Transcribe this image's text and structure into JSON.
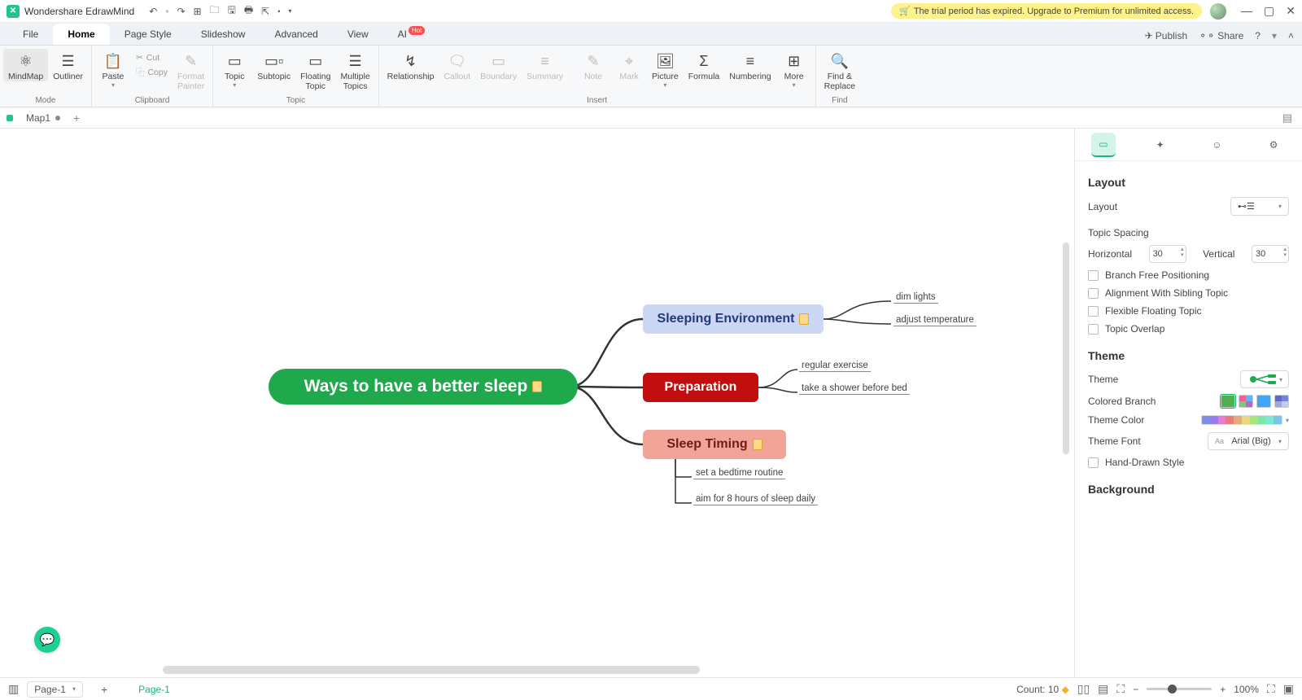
{
  "title_bar": {
    "app_name": "Wondershare EdrawMind",
    "trial_banner": "The trial period has expired. Upgrade to Premium for unlimited access."
  },
  "menu": {
    "file": "File",
    "home": "Home",
    "page_style": "Page Style",
    "slideshow": "Slideshow",
    "advanced": "Advanced",
    "view": "View",
    "ai": "AI",
    "ai_badge": "Hot",
    "publish": "Publish",
    "share": "Share"
  },
  "ribbon": {
    "mode": {
      "group": "Mode",
      "mindmap": "MindMap",
      "outliner": "Outliner"
    },
    "clipboard": {
      "group": "Clipboard",
      "paste": "Paste",
      "cut": "Cut",
      "copy": "Copy",
      "format": "Format\nPainter"
    },
    "topic": {
      "group": "Topic",
      "topic": "Topic",
      "subtopic": "Subtopic",
      "floating": "Floating\nTopic",
      "multiple": "Multiple\nTopics"
    },
    "insert": {
      "group": "Insert",
      "relationship": "Relationship",
      "callout": "Callout",
      "boundary": "Boundary",
      "summary": "Summary",
      "note": "Note",
      "mark": "Mark",
      "picture": "Picture",
      "formula": "Formula",
      "numbering": "Numbering",
      "more": "More"
    },
    "find": {
      "group": "Find",
      "find_replace": "Find &\nReplace"
    }
  },
  "tabs": {
    "map1": "Map1"
  },
  "mindmap": {
    "root": "Ways to have a  better sleep",
    "env": "Sleeping Environment",
    "env_children": [
      "dim lights",
      "adjust temperature"
    ],
    "prep": "Preparation",
    "prep_children": [
      "regular exercise",
      "take a shower before bed"
    ],
    "timing": "Sleep Timing",
    "timing_children": [
      "set a bedtime routine",
      "aim for 8 hours of sleep daily"
    ]
  },
  "panel": {
    "layout_title": "Layout",
    "layout_label": "Layout",
    "spacing_title": "Topic Spacing",
    "horizontal": "Horizontal",
    "horizontal_val": "30",
    "vertical": "Vertical",
    "vertical_val": "30",
    "branch_free": "Branch Free Positioning",
    "align_sibling": "Alignment With Sibling Topic",
    "flex_float": "Flexible Floating Topic",
    "overlap": "Topic Overlap",
    "theme_title": "Theme",
    "theme_label": "Theme",
    "colored_branch": "Colored Branch",
    "theme_color": "Theme Color",
    "theme_font": "Theme Font",
    "theme_font_val": "Arial (Big)",
    "hand_drawn": "Hand-Drawn Style",
    "background_title": "Background"
  },
  "status": {
    "page_select": "Page-1",
    "page_tab": "Page-1",
    "count_label": "Count: ",
    "count_val": "10",
    "zoom": "100%"
  }
}
